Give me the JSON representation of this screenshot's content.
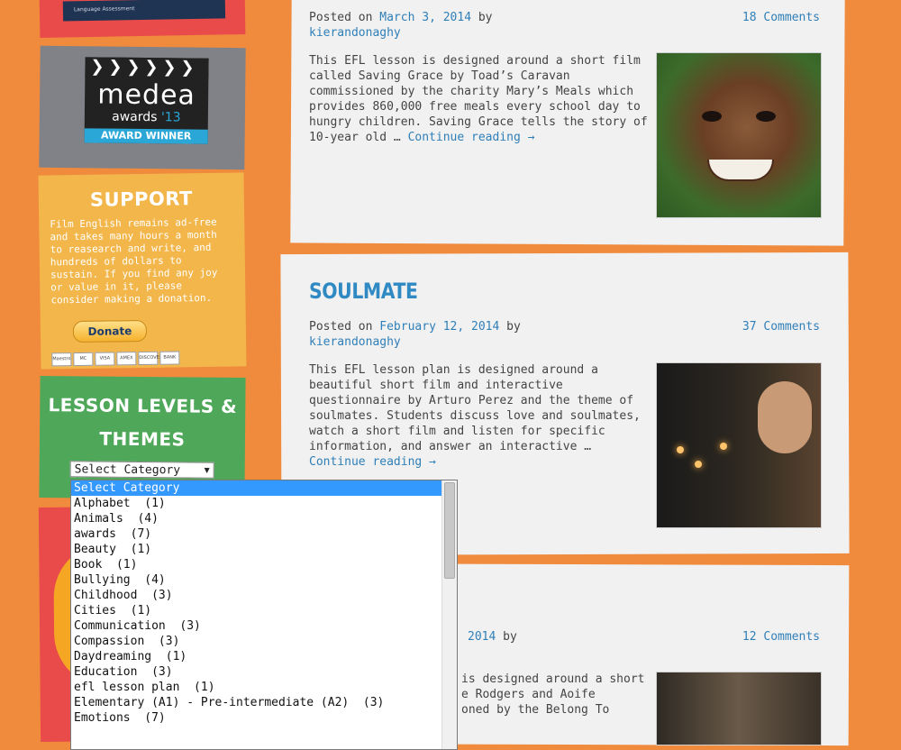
{
  "sidebar": {
    "medea": {
      "word": "medea",
      "awards": "awards",
      "year": "'13",
      "winner": "AWARD WINNER"
    },
    "support": {
      "title": "SUPPORT",
      "text": "Film English remains ad-free and takes many hours a month to reasearch and write, and hundreds of dollars to sustain. If you find any joy or value in it, please consider making a donation.",
      "donate_label": "Donate",
      "cards": [
        "Maestro",
        "MC",
        "VISA",
        "AMEX",
        "DISCOVER",
        "BANK"
      ]
    },
    "levels": {
      "title": "LESSON LEVELS & THEMES",
      "select_value": "Select Category",
      "options": [
        "Select Category",
        "Alphabet  (1)",
        "Animals  (4)",
        "awards  (7)",
        "Beauty  (1)",
        "Book  (1)",
        "Bullying  (4)",
        "Childhood  (3)",
        "Cities  (1)",
        "Communication  (3)",
        "Compassion  (3)",
        "Daydreaming  (1)",
        "Education  (3)",
        "efl lesson plan  (1)",
        "Elementary (A1) - Pre-intermediate (A2)  (3)",
        "Emotions  (7)"
      ]
    }
  },
  "posts": [
    {
      "posted_on": "Posted on",
      "date": "March 3, 2014",
      "by": "by",
      "author": "kierandonaghy",
      "comments": "18 Comments",
      "excerpt": "This EFL lesson is designed around a short film called Saving Grace by Toad’s Caravan commissioned by the charity Mary’s Meals which provides 860,000 free meals every school day to hungry children. Saving Grace tells the story of 10-year old …",
      "continue": "Continue reading →"
    },
    {
      "title": "SOULMATE",
      "posted_on": "Posted on",
      "date": "February 12, 2014",
      "by": "by",
      "author": "kierandonaghy",
      "comments": "37 Comments",
      "excerpt": "This EFL lesson plan is designed around a beautiful short film and interactive questionnaire by Arturo Perez and the theme of soulmates. Students discuss love and soulmates, watch a short film and listen for specific information, and answer an interactive …",
      "continue": "Continue reading →"
    },
    {
      "date_fragment": "2014",
      "by": "by",
      "comments": "12 Comments",
      "excerpt_lines": [
        "is designed around a short",
        "e Rodgers and Aoife",
        "oned by the Belong To"
      ]
    }
  ]
}
